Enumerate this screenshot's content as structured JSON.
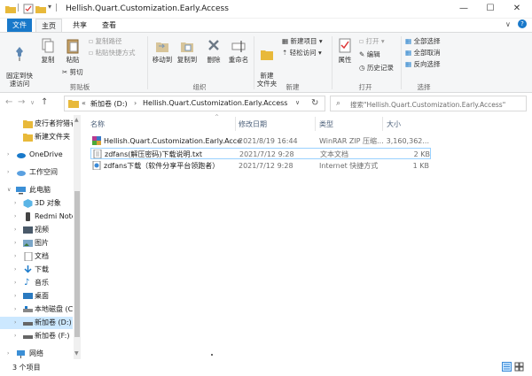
{
  "window": {
    "title": "Hellish.Quart.Customization.Early.Access",
    "controls": [
      "minimize",
      "maximize",
      "close"
    ]
  },
  "menu_tabs": {
    "file": "文件",
    "home": "主页",
    "share": "共享",
    "view": "查看"
  },
  "ribbon": {
    "clipboard": {
      "label": "剪贴板",
      "pin": "固定到快\n速访问",
      "copy": "复制",
      "paste": "粘贴",
      "copy_path": "复制路径",
      "paste_shortcut": "粘贴快捷方式",
      "cut": "剪切"
    },
    "organize": {
      "label": "组织",
      "move_to": "移动到",
      "copy_to": "复制到",
      "delete": "删除",
      "rename": "重命名"
    },
    "new": {
      "label": "新建",
      "new_folder": "新建\n文件夹",
      "new_item": "新建项目",
      "easy_access": "轻松访问"
    },
    "open": {
      "label": "打开",
      "properties": "属性",
      "open": "打开",
      "edit": "编辑",
      "history": "历史记录"
    },
    "select": {
      "label": "选择",
      "select_all": "全部选择",
      "select_none": "全部取消",
      "invert": "反向选择"
    }
  },
  "address": {
    "path_root": "新加卷 (D:)",
    "path_leaf": "Hellish.Quart.Customization.Early.Access",
    "search_placeholder": "搜索\"Hellish.Quart.Customization.Early.Access\""
  },
  "sidebar": {
    "items": [
      {
        "label": "皮行者狩猎者",
        "icon": "folder-icon"
      },
      {
        "label": "新建文件夹",
        "icon": "folder-icon"
      },
      {
        "label": "OneDrive",
        "icon": "cloud-icon"
      },
      {
        "label": "工作空间",
        "icon": "cloud-icon"
      },
      {
        "label": "此电脑",
        "icon": "computer-icon"
      },
      {
        "label": "3D 对象",
        "icon": "cube-icon"
      },
      {
        "label": "Redmi Note",
        "icon": "phone-icon"
      },
      {
        "label": "视频",
        "icon": "video-icon"
      },
      {
        "label": "图片",
        "icon": "picture-icon"
      },
      {
        "label": "文档",
        "icon": "document-icon"
      },
      {
        "label": "下载",
        "icon": "download-icon"
      },
      {
        "label": "音乐",
        "icon": "music-icon"
      },
      {
        "label": "桌面",
        "icon": "desktop-icon"
      },
      {
        "label": "本地磁盘 (C:)",
        "icon": "drive-icon"
      },
      {
        "label": "新加卷 (D:)",
        "icon": "drive-icon"
      },
      {
        "label": "新加卷 (F:)",
        "icon": "drive-icon"
      },
      {
        "label": "网络",
        "icon": "network-icon"
      }
    ]
  },
  "columns": {
    "name": "名称",
    "date": "修改日期",
    "type": "类型",
    "size": "大小"
  },
  "files": [
    {
      "name": "Hellish.Quart.Customization.Early.Acce...",
      "date": "2021/8/19 16:44",
      "type": "WinRAR ZIP 压缩...",
      "size": "3,160,362...",
      "icon": "winrar-archive-icon"
    },
    {
      "name": "zdfans(解压密码)下载说明.txt",
      "date": "2021/7/12 9:28",
      "type": "文本文档",
      "size": "2 KB",
      "icon": "text-file-icon"
    },
    {
      "name": "zdfans下载（软件分享平台领跑者）",
      "date": "2021/7/12 9:28",
      "type": "Internet 快捷方式",
      "size": "1 KB",
      "icon": "internet-shortcut-icon"
    }
  ],
  "status": {
    "item_count": "3 个项目"
  },
  "colors": {
    "accent": "#1979ca",
    "selection": "#cce8ff",
    "folder": "#e8b93a",
    "header_text": "#4c607a"
  }
}
